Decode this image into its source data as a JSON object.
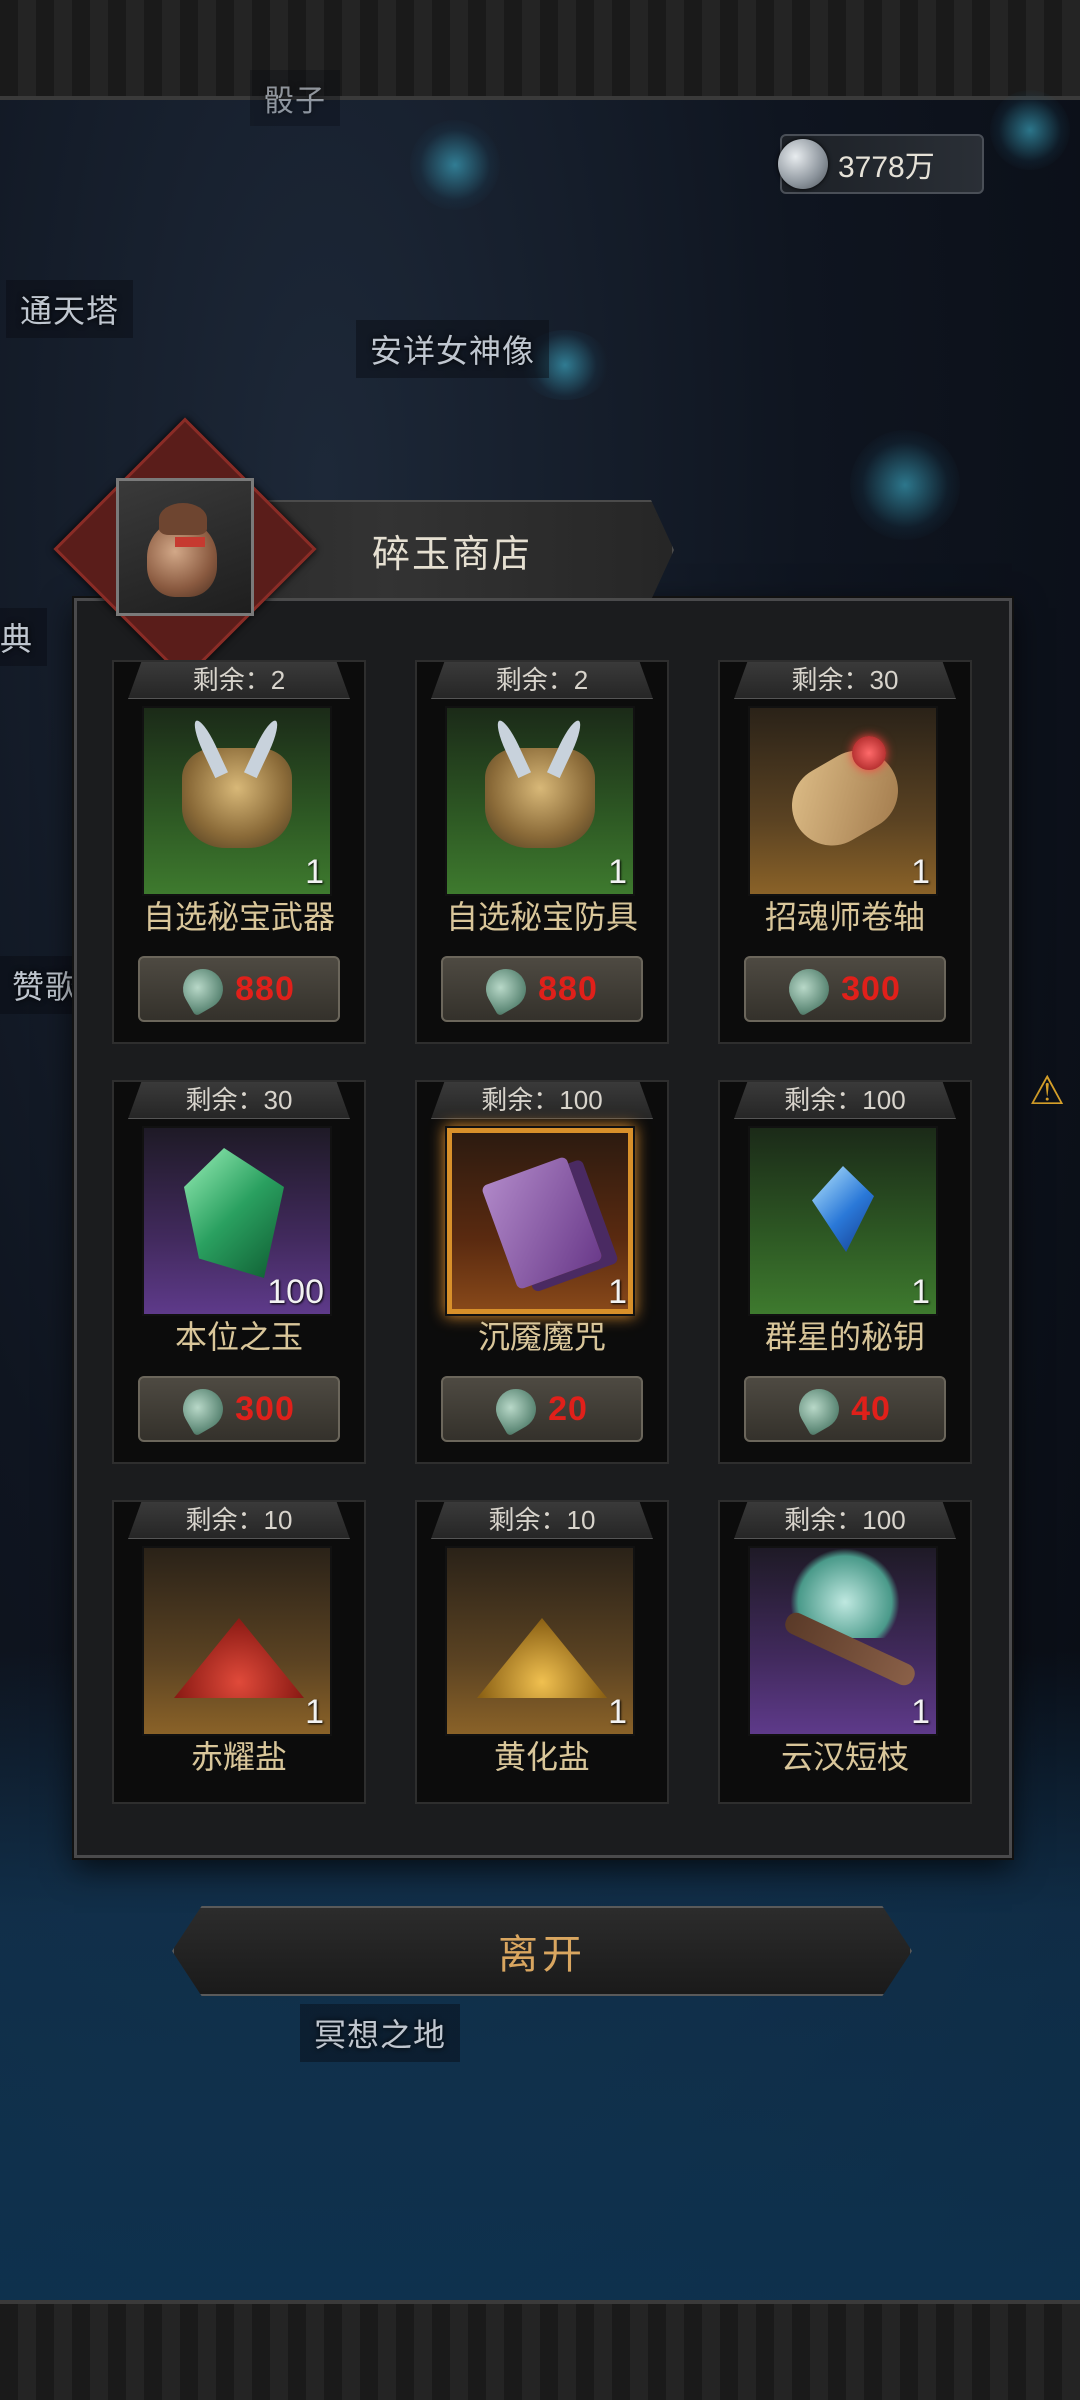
{
  "header": {
    "partial_label": "骰子"
  },
  "currency": {
    "value": "3778万",
    "icon": "silver-ore-icon"
  },
  "map_labels": {
    "tower": "通天塔",
    "statue": "安详女神像",
    "left_edge_1": "典",
    "left_edge_2": "赞歌",
    "meditation": "冥想之地"
  },
  "shop": {
    "title": "碎玉商店",
    "items": [
      {
        "remain": "剩余：2",
        "name": "自选秘宝武器",
        "qty": "1",
        "price": "880",
        "rarity": "green"
      },
      {
        "remain": "剩余：2",
        "name": "自选秘宝防具",
        "qty": "1",
        "price": "880",
        "rarity": "green"
      },
      {
        "remain": "剩余：30",
        "name": "招魂师卷轴",
        "qty": "1",
        "price": "300",
        "rarity": "orange"
      },
      {
        "remain": "剩余：30",
        "name": "本位之玉",
        "qty": "100",
        "price": "300",
        "rarity": "purple"
      },
      {
        "remain": "剩余：100",
        "name": "沉魇魔咒",
        "qty": "1",
        "price": "20",
        "rarity": "gold"
      },
      {
        "remain": "剩余：100",
        "name": "群星的秘钥",
        "qty": "1",
        "price": "40",
        "rarity": "green"
      },
      {
        "remain": "剩余：10",
        "name": "赤耀盐",
        "qty": "1",
        "price": "",
        "rarity": "orange"
      },
      {
        "remain": "剩余：10",
        "name": "黄化盐",
        "qty": "1",
        "price": "",
        "rarity": "orange"
      },
      {
        "remain": "剩余：100",
        "name": "云汉短枝",
        "qty": "1",
        "price": "",
        "rarity": "purple"
      }
    ]
  },
  "leave_button": "离开",
  "colors": {
    "price_text": "#e0201a",
    "name_text": "#d9c69a",
    "leave_text": "#d9a660"
  }
}
